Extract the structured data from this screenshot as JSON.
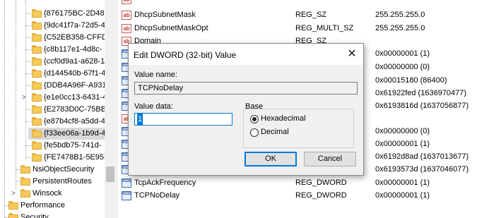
{
  "tree": {
    "items": [
      {
        "label": "{876175BC-2D48-"
      },
      {
        "label": "{9dc41f7a-72d5-4"
      },
      {
        "label": "{C52EB358-CFFD-"
      },
      {
        "label": "{c8b117e1-4d8c-"
      },
      {
        "label": "{ccf0d9a1-a628-1"
      },
      {
        "label": "{d144540b-67f1-4"
      },
      {
        "label": "{DDB4A96F-A931"
      },
      {
        "label": "{e1e0cc13-6431-4"
      },
      {
        "label": "{E2783D0C-75BB-"
      },
      {
        "label": "{e87b4cf8-a5dd-4"
      },
      {
        "label": "{f33ee06a-1b9d-4"
      },
      {
        "label": "{fe5bdb75-741d-"
      },
      {
        "label": "{FE7478B1-5E95-4"
      },
      {
        "label": "NsiObjectSecurity"
      },
      {
        "label": "PersistentRoutes"
      },
      {
        "label": "Winsock"
      },
      {
        "label": "Performance"
      },
      {
        "label": "Security"
      }
    ]
  },
  "list": {
    "rows": [
      {
        "name": "",
        "type": "",
        "data": "",
        "icon": "ab"
      },
      {
        "name": "DhcpSubnetMask",
        "type": "REG_SZ",
        "data": "255.255.255.0",
        "icon": "ab"
      },
      {
        "name": "DhcpSubnetMaskOpt",
        "type": "REG_MULTI_SZ",
        "data": "255.255.255.0",
        "icon": "ab"
      },
      {
        "name": "Domain",
        "type": "REG_SZ",
        "data": "",
        "icon": "ab"
      },
      {
        "name": "",
        "type": "",
        "data": "0x00000001 (1)",
        "icon": "bin"
      },
      {
        "name": "",
        "type": "",
        "data": "0x00000000 (0)",
        "icon": "bin"
      },
      {
        "name": "",
        "type": "",
        "data": "0x00015180 (86400)",
        "icon": "bin"
      },
      {
        "name": "",
        "type": "",
        "data": "0x61922fed (1636970477)",
        "icon": "bin"
      },
      {
        "name": "",
        "type": "",
        "data": "0x6193816d (1637056877)",
        "icon": "bin"
      },
      {
        "name": "",
        "type": "",
        "data": "",
        "icon": "ab"
      },
      {
        "name": "",
        "type": "",
        "data": "0x00000000 (0)",
        "icon": "bin"
      },
      {
        "name": "",
        "type": "",
        "data": "0x00000001 (1)",
        "icon": "bin"
      },
      {
        "name": "",
        "type": "",
        "data": "0x6192d8ad (1637013677)",
        "icon": "bin"
      },
      {
        "name": "",
        "type": "",
        "data": "0x6193573d (1637046077)",
        "icon": "bin"
      },
      {
        "name": "TcpAckFrequency",
        "type": "REG_DWORD",
        "data": "0x00000001 (1)",
        "icon": "bin"
      },
      {
        "name": "TCPNoDelay",
        "type": "REG_DWORD",
        "data": "0x00000001 (1)",
        "icon": "bin"
      }
    ]
  },
  "dialog": {
    "title": "Edit DWORD (32-bit) Value",
    "close_glyph": "✕",
    "value_name_label": "Value name:",
    "value_name": "TCPNoDelay",
    "value_data_label": "Value data:",
    "value_data": "1",
    "base_label": "Base",
    "hex_label": "Hexadecimal",
    "dec_label": "Decimal",
    "ok_label": "OK",
    "cancel_label": "Cancel"
  }
}
